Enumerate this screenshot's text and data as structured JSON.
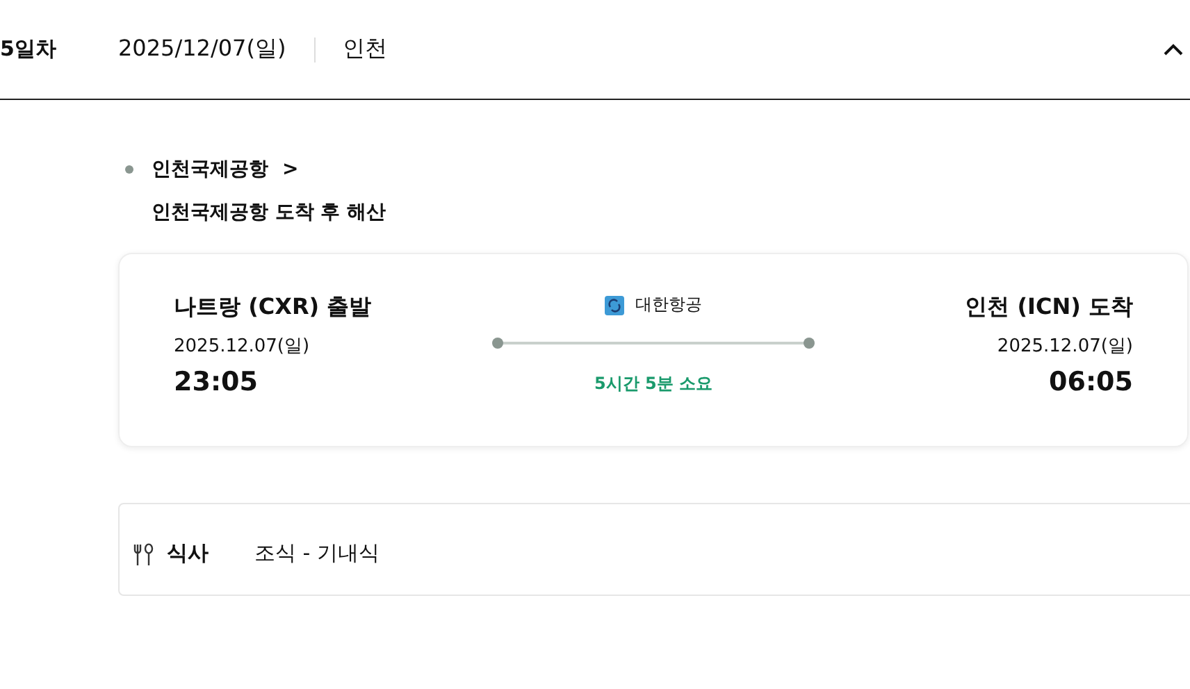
{
  "day": {
    "label": "5일차",
    "date": "2025/12/07(일)",
    "city": "인천",
    "expanded": true
  },
  "place": {
    "name": "인천국제공항",
    "arrow": ">",
    "note": "인천국제공항 도착 후 해산"
  },
  "flight": {
    "departure": {
      "name": "나트랑 (CXR) 출발",
      "date": "2025.12.07(일)",
      "time": "23:05"
    },
    "airline": "대한항공",
    "duration": "5시간 5분 소요",
    "arrival": {
      "name": "인천 (ICN) 도착",
      "date": "2025.12.07(일)",
      "time": "06:05"
    }
  },
  "meal": {
    "label": "식사",
    "value": "조식 - 기내식"
  }
}
